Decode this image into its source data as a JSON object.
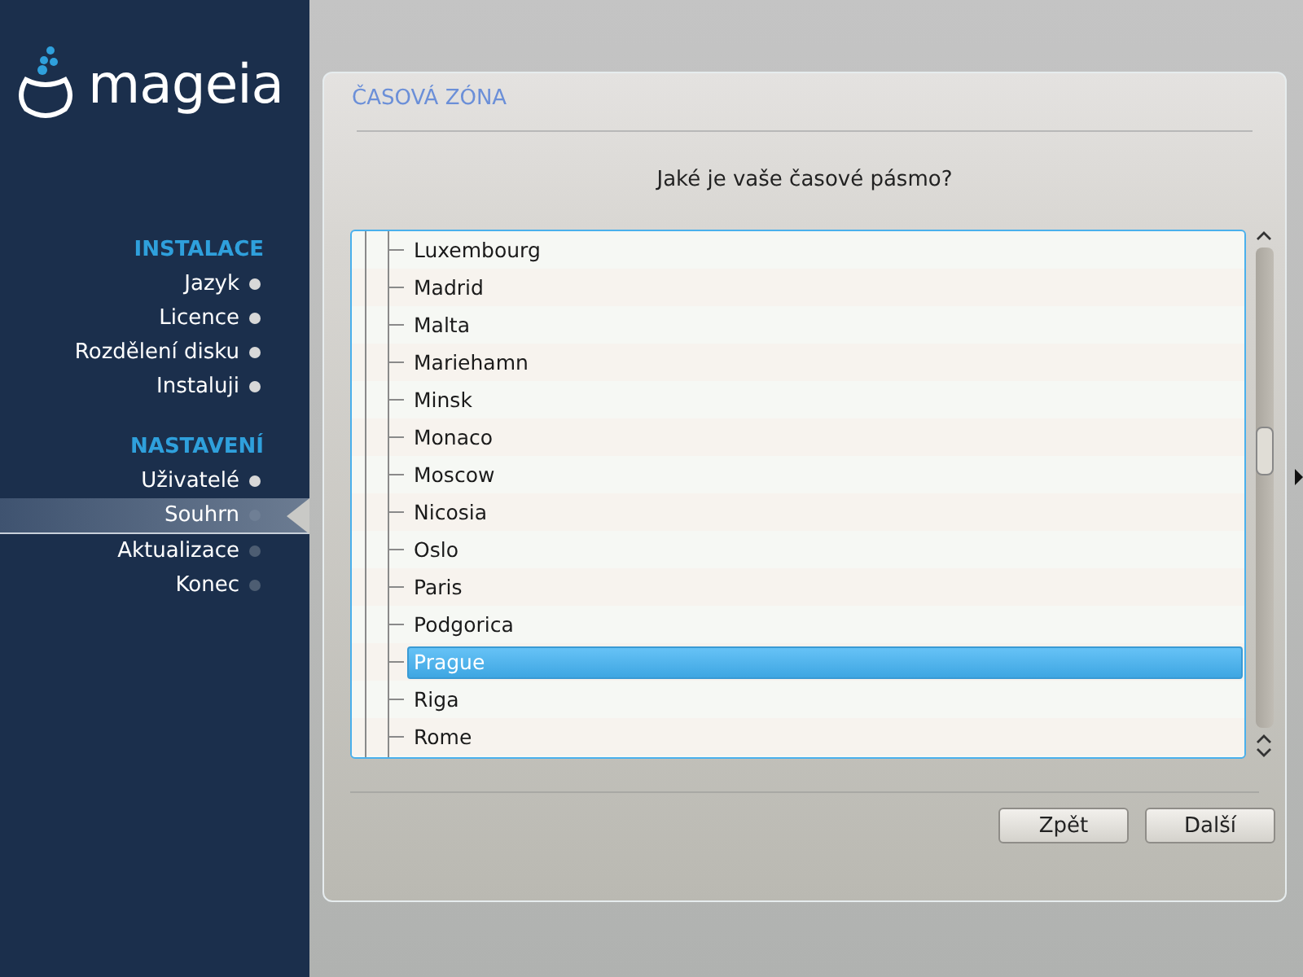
{
  "sidebar": {
    "logo": "mageia",
    "sections": [
      {
        "title": "INSTALACE",
        "items": [
          {
            "label": "Jazyk",
            "done": true,
            "selected": false
          },
          {
            "label": "Licence",
            "done": true,
            "selected": false
          },
          {
            "label": "Rozdělení disku",
            "done": true,
            "selected": false
          },
          {
            "label": "Instaluji",
            "done": true,
            "selected": false
          }
        ]
      },
      {
        "title": "NASTAVENÍ",
        "items": [
          {
            "label": "Uživatelé",
            "done": true,
            "selected": false
          },
          {
            "label": "Souhrn",
            "done": false,
            "selected": true
          },
          {
            "label": "Aktualizace",
            "done": false,
            "selected": false
          },
          {
            "label": "Konec",
            "done": false,
            "selected": false
          }
        ]
      }
    ]
  },
  "panel": {
    "title": "ČASOVÁ ZÓNA",
    "question": "Jaké je vaše časové pásmo?",
    "timezones": [
      {
        "label": "Luxembourg",
        "selected": false
      },
      {
        "label": "Madrid",
        "selected": false
      },
      {
        "label": "Malta",
        "selected": false
      },
      {
        "label": "Mariehamn",
        "selected": false
      },
      {
        "label": "Minsk",
        "selected": false
      },
      {
        "label": "Monaco",
        "selected": false
      },
      {
        "label": "Moscow",
        "selected": false
      },
      {
        "label": "Nicosia",
        "selected": false
      },
      {
        "label": "Oslo",
        "selected": false
      },
      {
        "label": "Paris",
        "selected": false
      },
      {
        "label": "Podgorica",
        "selected": false
      },
      {
        "label": "Prague",
        "selected": true
      },
      {
        "label": "Riga",
        "selected": false
      },
      {
        "label": "Rome",
        "selected": false
      }
    ],
    "buttons": [
      "Zpět",
      "Další"
    ]
  }
}
